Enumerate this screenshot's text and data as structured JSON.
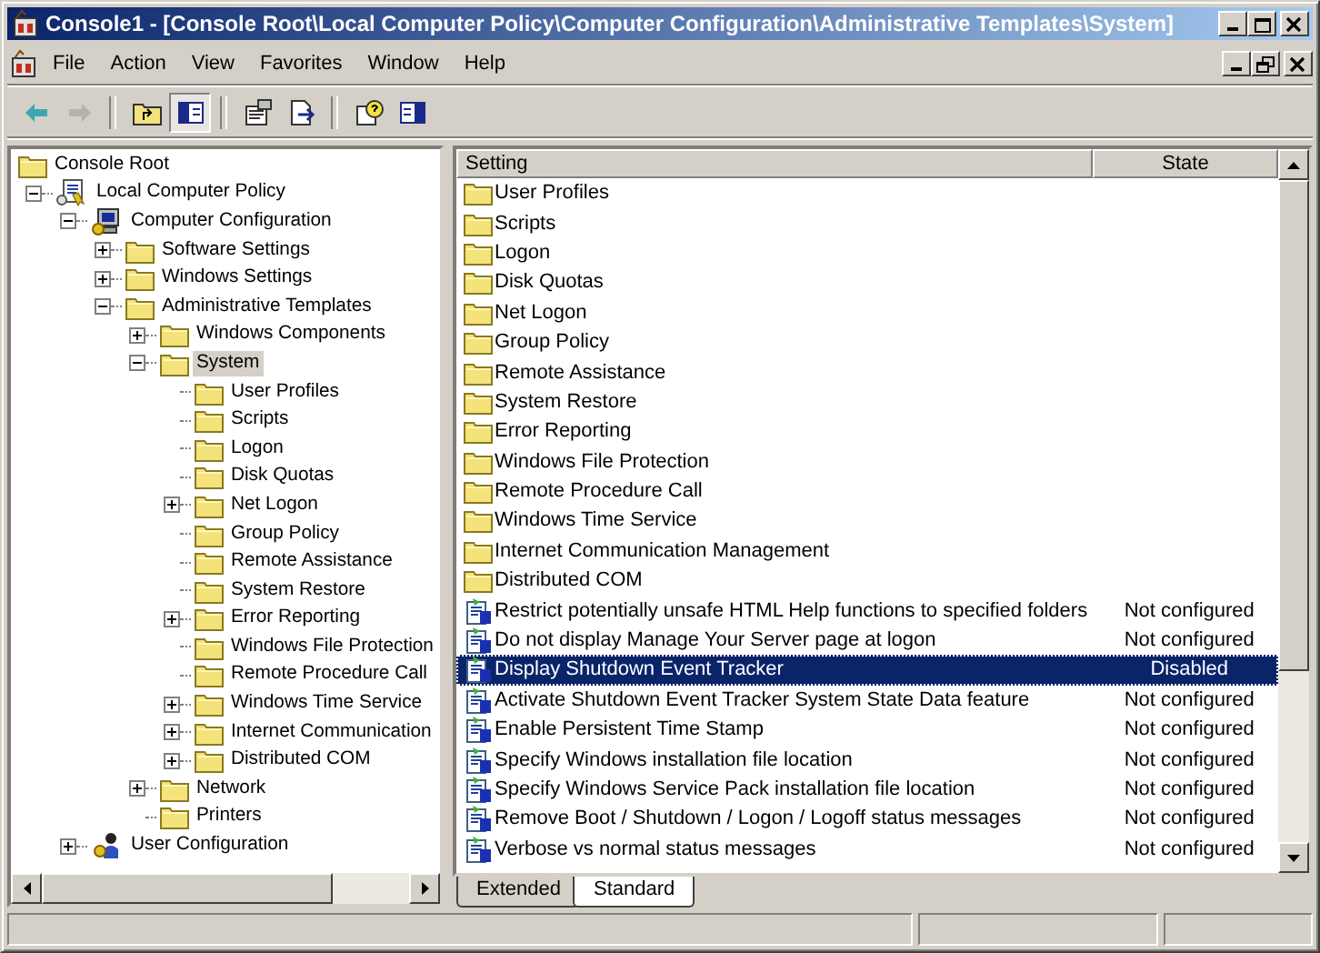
{
  "window": {
    "title": "Console1 - [Console Root\\Local Computer Policy\\Computer Configuration\\Administrative Templates\\System]"
  },
  "menu": [
    "File",
    "Action",
    "View",
    "Favorites",
    "Window",
    "Help"
  ],
  "toolbar": [
    {
      "kind": "back",
      "disabled": false,
      "pressed": false
    },
    {
      "kind": "forward",
      "disabled": true,
      "pressed": false
    },
    {
      "kind": "sep"
    },
    {
      "kind": "up",
      "disabled": false,
      "pressed": false
    },
    {
      "kind": "tree",
      "disabled": false,
      "pressed": true
    },
    {
      "kind": "sep"
    },
    {
      "kind": "properties",
      "disabled": false,
      "pressed": false
    },
    {
      "kind": "export",
      "disabled": false,
      "pressed": false
    },
    {
      "kind": "sep"
    },
    {
      "kind": "help",
      "disabled": false,
      "pressed": false
    },
    {
      "kind": "pane",
      "disabled": false,
      "pressed": false
    }
  ],
  "tree": [
    {
      "label": "Console Root",
      "kind": "folder",
      "selected": false,
      "children": [
        {
          "label": "Local Computer Policy",
          "kind": "policy",
          "expanded": true,
          "selected": false,
          "children": [
            {
              "label": "Computer Configuration",
              "kind": "computer",
              "expanded": true,
              "selected": false,
              "children": [
                {
                  "label": "Software Settings",
                  "kind": "folder",
                  "expanded": false,
                  "selected": false
                },
                {
                  "label": "Windows Settings",
                  "kind": "folder",
                  "expanded": false,
                  "selected": false
                },
                {
                  "label": "Administrative Templates",
                  "kind": "folder",
                  "expanded": true,
                  "selected": false,
                  "children": [
                    {
                      "label": "Windows Components",
                      "kind": "folder",
                      "expanded": false,
                      "selected": false
                    },
                    {
                      "label": "System",
                      "kind": "folder",
                      "expanded": true,
                      "selected": true,
                      "children": [
                        {
                          "label": "User Profiles",
                          "kind": "folder",
                          "selected": false
                        },
                        {
                          "label": "Scripts",
                          "kind": "folder",
                          "selected": false
                        },
                        {
                          "label": "Logon",
                          "kind": "folder",
                          "selected": false
                        },
                        {
                          "label": "Disk Quotas",
                          "kind": "folder",
                          "selected": false
                        },
                        {
                          "label": "Net Logon",
                          "kind": "folder",
                          "expanded": false,
                          "selected": false
                        },
                        {
                          "label": "Group Policy",
                          "kind": "folder",
                          "selected": false
                        },
                        {
                          "label": "Remote Assistance",
                          "kind": "folder",
                          "selected": false
                        },
                        {
                          "label": "System Restore",
                          "kind": "folder",
                          "selected": false
                        },
                        {
                          "label": "Error Reporting",
                          "kind": "folder",
                          "expanded": false,
                          "selected": false
                        },
                        {
                          "label": "Windows File Protection",
                          "kind": "folder",
                          "selected": false
                        },
                        {
                          "label": "Remote Procedure Call",
                          "kind": "folder",
                          "selected": false
                        },
                        {
                          "label": "Windows Time Service",
                          "kind": "folder",
                          "expanded": false,
                          "selected": false
                        },
                        {
                          "label": "Internet Communication",
                          "kind": "folder",
                          "expanded": false,
                          "selected": false
                        },
                        {
                          "label": "Distributed COM",
                          "kind": "folder",
                          "expanded": false,
                          "selected": false
                        }
                      ]
                    },
                    {
                      "label": "Network",
                      "kind": "folder",
                      "expanded": false,
                      "selected": false
                    },
                    {
                      "label": "Printers",
                      "kind": "folder",
                      "selected": false
                    }
                  ]
                }
              ]
            },
            {
              "label": "User Configuration",
              "kind": "users",
              "expanded": false,
              "selected": false
            }
          ]
        }
      ]
    }
  ],
  "list": {
    "columns": [
      "Setting",
      "State"
    ],
    "rows": [
      {
        "kind": "folder",
        "setting": "User Profiles",
        "selected": false
      },
      {
        "kind": "folder",
        "setting": "Scripts",
        "selected": false
      },
      {
        "kind": "folder",
        "setting": "Logon",
        "selected": false
      },
      {
        "kind": "folder",
        "setting": "Disk Quotas",
        "selected": false
      },
      {
        "kind": "folder",
        "setting": "Net Logon",
        "selected": false
      },
      {
        "kind": "folder",
        "setting": "Group Policy",
        "selected": false
      },
      {
        "kind": "folder",
        "setting": "Remote Assistance",
        "selected": false
      },
      {
        "kind": "folder",
        "setting": "System Restore",
        "selected": false
      },
      {
        "kind": "folder",
        "setting": "Error Reporting",
        "selected": false
      },
      {
        "kind": "folder",
        "setting": "Windows File Protection",
        "selected": false
      },
      {
        "kind": "folder",
        "setting": "Remote Procedure Call",
        "selected": false
      },
      {
        "kind": "folder",
        "setting": "Windows Time Service",
        "selected": false
      },
      {
        "kind": "folder",
        "setting": "Internet Communication Management",
        "selected": false
      },
      {
        "kind": "folder",
        "setting": "Distributed COM",
        "selected": false
      },
      {
        "kind": "setting",
        "setting": "Restrict potentially unsafe HTML Help functions to specified folders",
        "state": "Not configured",
        "selected": false
      },
      {
        "kind": "setting",
        "setting": "Do not display Manage Your Server page at logon",
        "state": "Not configured",
        "selected": false
      },
      {
        "kind": "setting",
        "setting": "Display Shutdown Event Tracker",
        "state": "Disabled",
        "selected": true
      },
      {
        "kind": "setting",
        "setting": "Activate Shutdown Event Tracker System State Data feature",
        "state": "Not configured",
        "selected": false
      },
      {
        "kind": "setting",
        "setting": "Enable Persistent Time Stamp",
        "state": "Not configured",
        "selected": false
      },
      {
        "kind": "setting",
        "setting": "Specify Windows installation file location",
        "state": "Not configured",
        "selected": false
      },
      {
        "kind": "setting",
        "setting": "Specify Windows Service Pack installation file location",
        "state": "Not configured",
        "selected": false
      },
      {
        "kind": "setting",
        "setting": "Remove Boot / Shutdown / Logon / Logoff status messages",
        "state": "Not configured",
        "selected": false
      },
      {
        "kind": "setting",
        "setting": "Verbose vs normal status messages",
        "state": "Not configured",
        "selected": false
      }
    ]
  },
  "tabs": [
    {
      "label": "Extended",
      "selected": false
    },
    {
      "label": "Standard",
      "selected": true
    }
  ]
}
